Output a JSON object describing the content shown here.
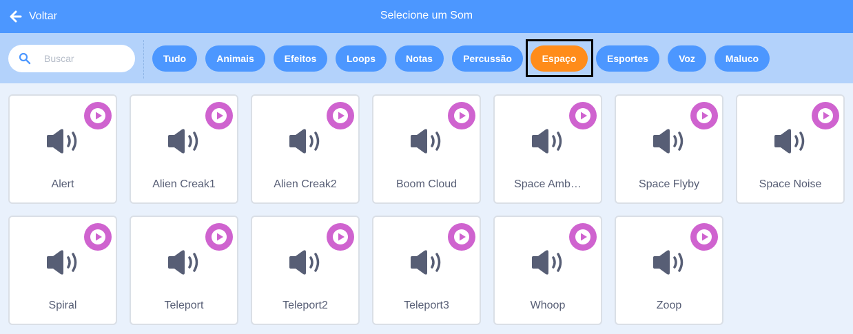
{
  "header": {
    "back_label": "Voltar",
    "title": "Selecione um Som"
  },
  "search": {
    "placeholder": "Buscar",
    "value": ""
  },
  "tags": [
    {
      "label": "Tudo",
      "active": false
    },
    {
      "label": "Animais",
      "active": false
    },
    {
      "label": "Efeitos",
      "active": false
    },
    {
      "label": "Loops",
      "active": false
    },
    {
      "label": "Notas",
      "active": false
    },
    {
      "label": "Percussão",
      "active": false
    },
    {
      "label": "Espaço",
      "active": true
    },
    {
      "label": "Esportes",
      "active": false
    },
    {
      "label": "Voz",
      "active": false
    },
    {
      "label": "Maluco",
      "active": false
    }
  ],
  "sounds": [
    {
      "name": "Alert"
    },
    {
      "name": "Alien Creak1"
    },
    {
      "name": "Alien Creak2"
    },
    {
      "name": "Boom Cloud"
    },
    {
      "name": "Space Amb…"
    },
    {
      "name": "Space Flyby"
    },
    {
      "name": "Space Noise"
    },
    {
      "name": "Spiral"
    },
    {
      "name": "Teleport"
    },
    {
      "name": "Teleport2"
    },
    {
      "name": "Teleport3"
    },
    {
      "name": "Whoop"
    },
    {
      "name": "Zoop"
    }
  ],
  "colors": {
    "header_blue": "#4c97ff",
    "filter_bar": "#b3d2fb",
    "active_tag": "#ff8c1a",
    "play_button": "#cf63cf",
    "speaker_icon": "#575e75"
  }
}
